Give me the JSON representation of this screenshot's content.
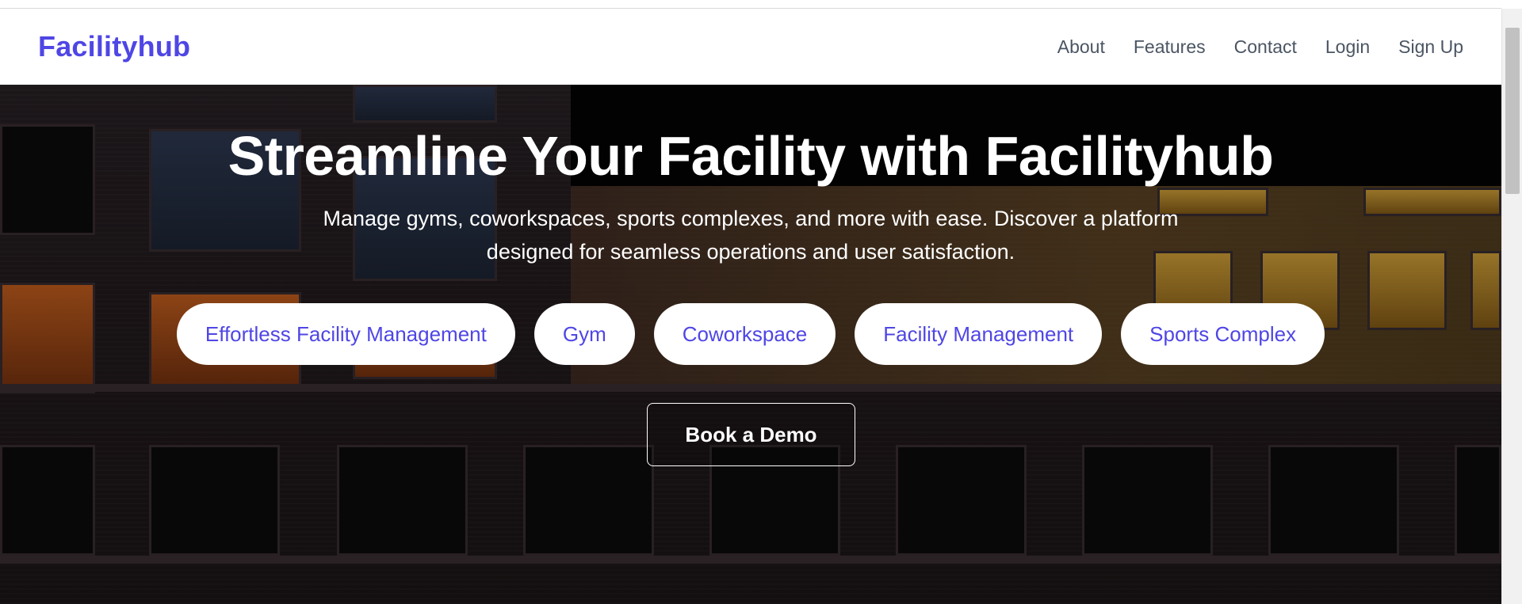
{
  "brand": {
    "name": "Facilityhub"
  },
  "nav": {
    "links": [
      "About",
      "Features",
      "Contact",
      "Login",
      "Sign Up"
    ]
  },
  "hero": {
    "title": "Streamline Your Facility with Facilityhub",
    "subtitle": "Manage gyms, coworkspaces, sports complexes, and more with ease. Discover a platform designed for seamless operations and user satisfaction.",
    "tags": [
      "Effortless Facility Management",
      "Gym",
      "Coworkspace",
      "Facility Management",
      "Sports Complex"
    ],
    "cta_label": "Book a Demo"
  },
  "colors": {
    "accent": "#4f46e5",
    "nav_text": "#4b5563",
    "hero_text": "#ffffff"
  }
}
